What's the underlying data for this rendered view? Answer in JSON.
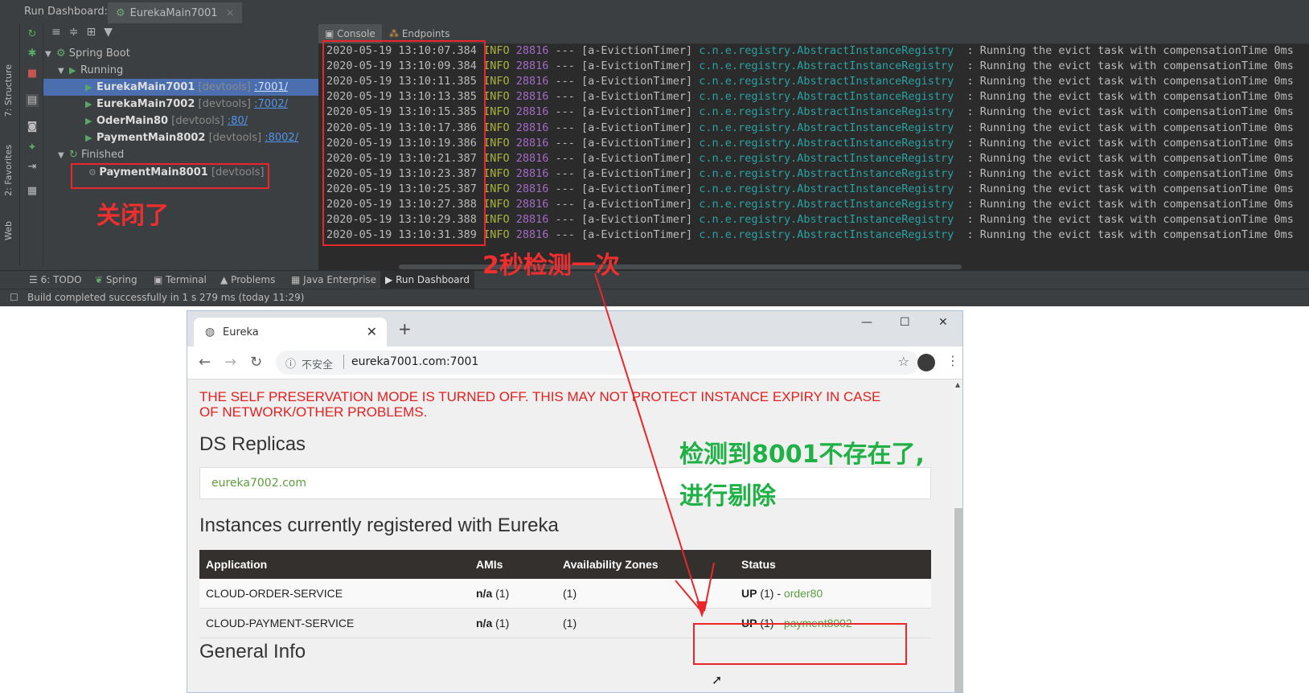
{
  "ide": {
    "title": "Run Dashboard:",
    "tab": "EurekaMain7001",
    "side_labels": [
      "7: Structure",
      "2: Favorites",
      "Web"
    ],
    "tree": {
      "root": "Spring Boot",
      "running_label": "Running",
      "running": [
        {
          "name": "EurekaMain7001",
          "tag": "[devtools]",
          "port": ":7001/"
        },
        {
          "name": "EurekaMain7002",
          "tag": "[devtools]",
          "port": ":7002/"
        },
        {
          "name": "OderMain80",
          "tag": "[devtools]",
          "port": ":80/"
        },
        {
          "name": "PaymentMain8002",
          "tag": "[devtools]",
          "port": ":8002/"
        }
      ],
      "finished_label": "Finished",
      "finished": [
        {
          "name": "PaymentMain8001",
          "tag": "[devtools]"
        }
      ]
    },
    "console_tabs": [
      "Console",
      "Endpoints"
    ],
    "log": {
      "level": "INFO",
      "pid": "28816",
      "sep": "---",
      "thread": "[a-EvictionTimer]",
      "logger": "c.n.e.registry.AbstractInstanceRegistry",
      "message": ": Running the evict task with compensationTime 0ms",
      "timestamps": [
        "2020-05-19 13:10:07.384",
        "2020-05-19 13:10:09.384",
        "2020-05-19 13:10:11.385",
        "2020-05-19 13:10:13.385",
        "2020-05-19 13:10:15.385",
        "2020-05-19 13:10:17.386",
        "2020-05-19 13:10:19.386",
        "2020-05-19 13:10:21.387",
        "2020-05-19 13:10:23.387",
        "2020-05-19 13:10:25.387",
        "2020-05-19 13:10:27.388",
        "2020-05-19 13:10:29.388",
        "2020-05-19 13:10:31.389"
      ]
    },
    "bottom_tabs": [
      "6: TODO",
      "Spring",
      "Terminal",
      "Problems",
      "Java Enterprise",
      "Run Dashboard"
    ],
    "status": "Build completed successfully in 1 s 279 ms (today 11:29)"
  },
  "annotations": {
    "closed": "关闭了",
    "interval": "2秒检测一次",
    "removed_line1": "检测到8001不存在了,",
    "removed_line2": "进行剔除"
  },
  "browser": {
    "tab_title": "Eureka",
    "not_secure": "不安全",
    "url": "eureka7001.com:7001",
    "warning": "THE SELF PRESERVATION MODE IS TURNED OFF. THIS MAY NOT PROTECT INSTANCE EXPIRY IN CASE OF NETWORK/OTHER PROBLEMS.",
    "ds_replicas_title": "DS Replicas",
    "replica": "eureka7002.com",
    "instances_title": "Instances currently registered with Eureka",
    "columns": [
      "Application",
      "AMIs",
      "Availability Zones",
      "Status"
    ],
    "rows": [
      {
        "app": "CLOUD-ORDER-SERVICE",
        "amis": "n/a",
        "amis_count": "(1)",
        "zones": "(1)",
        "status": "UP",
        "status_count": "(1) -",
        "instance": "order80"
      },
      {
        "app": "CLOUD-PAYMENT-SERVICE",
        "amis": "n/a",
        "amis_count": "(1)",
        "zones": "(1)",
        "status": "UP",
        "status_count": "(1) -",
        "instance": "payment8002"
      }
    ],
    "general_info_title": "General Info"
  }
}
